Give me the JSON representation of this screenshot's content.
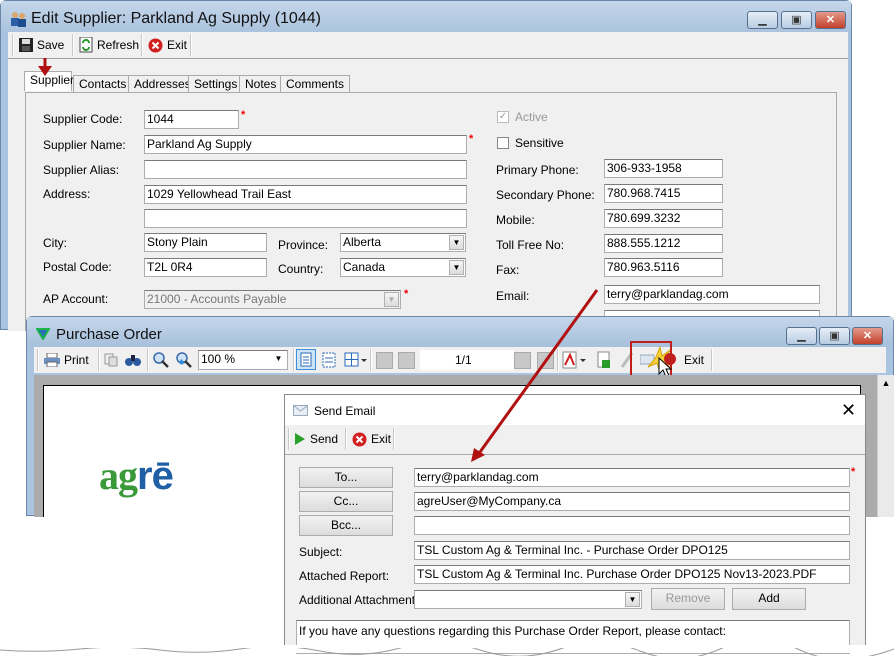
{
  "supplier_window": {
    "title": "Edit Supplier: Parkland Ag Supply (1044)",
    "toolbar": {
      "save": "Save",
      "refresh": "Refresh",
      "exit": "Exit"
    },
    "tabs": [
      "Supplier",
      "Contacts",
      "Addresses",
      "Settings",
      "Notes",
      "Comments"
    ],
    "active_tab": "Supplier",
    "left_fields": {
      "supplier_code_label": "Supplier Code:",
      "supplier_code": "1044",
      "supplier_name_label": "Supplier Name:",
      "supplier_name": "Parkland Ag Supply",
      "supplier_alias_label": "Supplier Alias:",
      "supplier_alias": "",
      "address_label": "Address:",
      "address1": "1029 Yellowhead Trail East",
      "address2": "",
      "city_label": "City:",
      "city": "Stony Plain",
      "province_label": "Province:",
      "province": "Alberta",
      "postal_code_label": "Postal Code:",
      "postal_code": "T2L 0R4",
      "country_label": "Country:",
      "country": "Canada",
      "ap_account_label": "AP Account:",
      "ap_account": "21000 - Accounts Payable"
    },
    "right_fields": {
      "active_label": "Active",
      "active_checked": true,
      "sensitive_label": "Sensitive",
      "sensitive_checked": false,
      "primary_phone_label": "Primary Phone:",
      "primary_phone": "306-933-1958",
      "secondary_phone_label": "Secondary Phone:",
      "secondary_phone": "780.968.7415",
      "mobile_label": "Mobile:",
      "mobile": "780.699.3232",
      "toll_free_label": "Toll Free No:",
      "toll_free": "888.555.1212",
      "fax_label": "Fax:",
      "fax": "780.963.5116",
      "email_label": "Email:",
      "email": "terry@parklandag.com"
    },
    "required_marker": "*"
  },
  "po_window": {
    "title": "Purchase Order",
    "toolbar": {
      "print": "Print",
      "zoom": "100 %",
      "page": "1/1",
      "exit": "Exit"
    },
    "logo": {
      "part1": "ag",
      "part2": "rē",
      "color1": "#3a9a3a",
      "color2": "#1f5fa6"
    }
  },
  "email_dialog": {
    "title": "Send Email",
    "toolbar": {
      "send": "Send",
      "exit": "Exit"
    },
    "to_button": "To...",
    "to": "terry@parklandag.com",
    "cc_button": "Cc...",
    "cc": "agreUser@MyCompany.ca",
    "bcc_button": "Bcc...",
    "bcc": "",
    "subject_label": "Subject:",
    "subject": "TSL Custom Ag & Terminal Inc. - Purchase Order DPO125",
    "attached_label": "Attached Report:",
    "attached": "TSL Custom Ag & Terminal Inc. Purchase Order DPO125 Nov13-2023.PDF",
    "additional_label": "Additional Attachments",
    "additional": "",
    "remove_button": "Remove",
    "add_button": "Add",
    "body": "If you have any questions regarding this Purchase Order Report, please contact:"
  },
  "colors": {
    "annotation_arrow": "#b01010",
    "highlight_box": "#c0201a"
  }
}
